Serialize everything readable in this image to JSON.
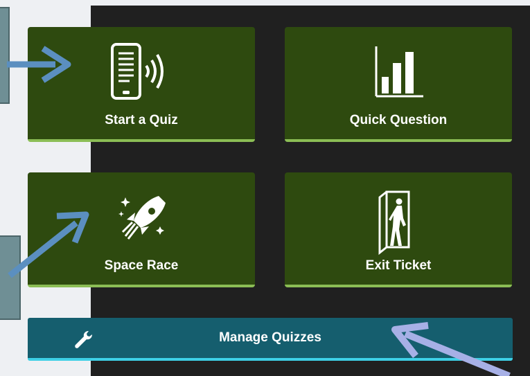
{
  "tiles": {
    "start_quiz": {
      "label": "Start a Quiz",
      "icon": "tablet-broadcast-icon"
    },
    "quick_question": {
      "label": "Quick Question",
      "icon": "bar-chart-icon"
    },
    "space_race": {
      "label": "Space Race",
      "icon": "rocket-icon"
    },
    "exit_ticket": {
      "label": "Exit Ticket",
      "icon": "exit-door-icon"
    }
  },
  "manage": {
    "label": "Manage Quizzes",
    "icon": "wrench-icon"
  },
  "colors": {
    "tile_bg": "#2e4a0f",
    "tile_accent": "#8bbd55",
    "manage_bg": "#155e6e",
    "manage_accent": "#3ed0e6",
    "panel_bg": "#202020",
    "annotation_arrow_blue": "#5b8fc0",
    "annotation_arrow_lavender": "#a7b0e6"
  }
}
